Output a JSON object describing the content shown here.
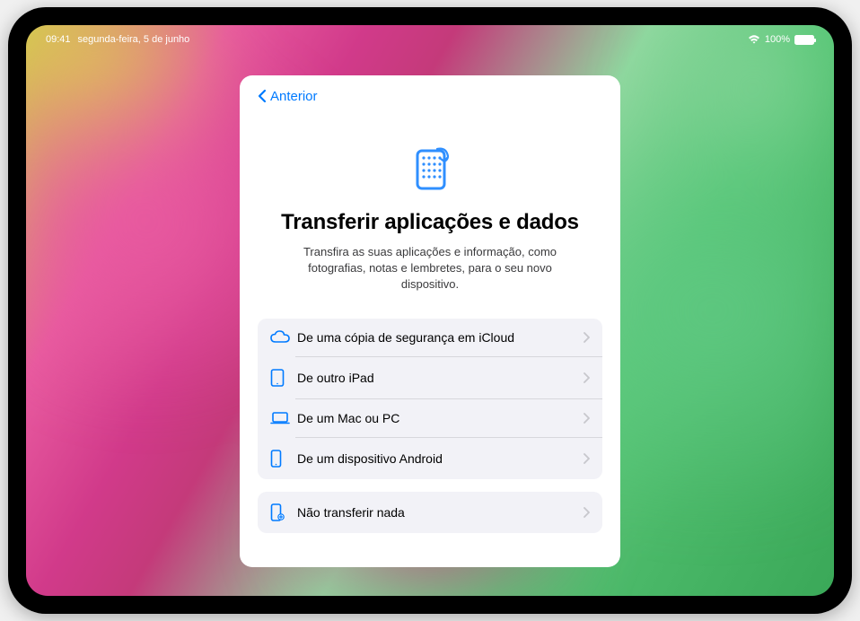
{
  "status": {
    "time": "09:41",
    "date": "segunda-feira, 5 de junho",
    "battery_pct": "100%"
  },
  "modal": {
    "back_label": "Anterior",
    "title": "Transferir aplicações e dados",
    "subtitle": "Transfira as suas aplicações e informação, como fotografias, notas e lembretes, para o seu novo dispositivo.",
    "options_primary": [
      {
        "label": "De uma cópia de segurança em iCloud",
        "icon": "cloud-icon"
      },
      {
        "label": "De outro iPad",
        "icon": "ipad-icon"
      },
      {
        "label": "De um Mac ou PC",
        "icon": "laptop-icon"
      },
      {
        "label": "De um dispositivo Android",
        "icon": "phone-icon"
      }
    ],
    "options_secondary": [
      {
        "label": "Não transferir nada",
        "icon": "phone-plus-icon"
      }
    ]
  },
  "colors": {
    "accent": "#007aff"
  }
}
